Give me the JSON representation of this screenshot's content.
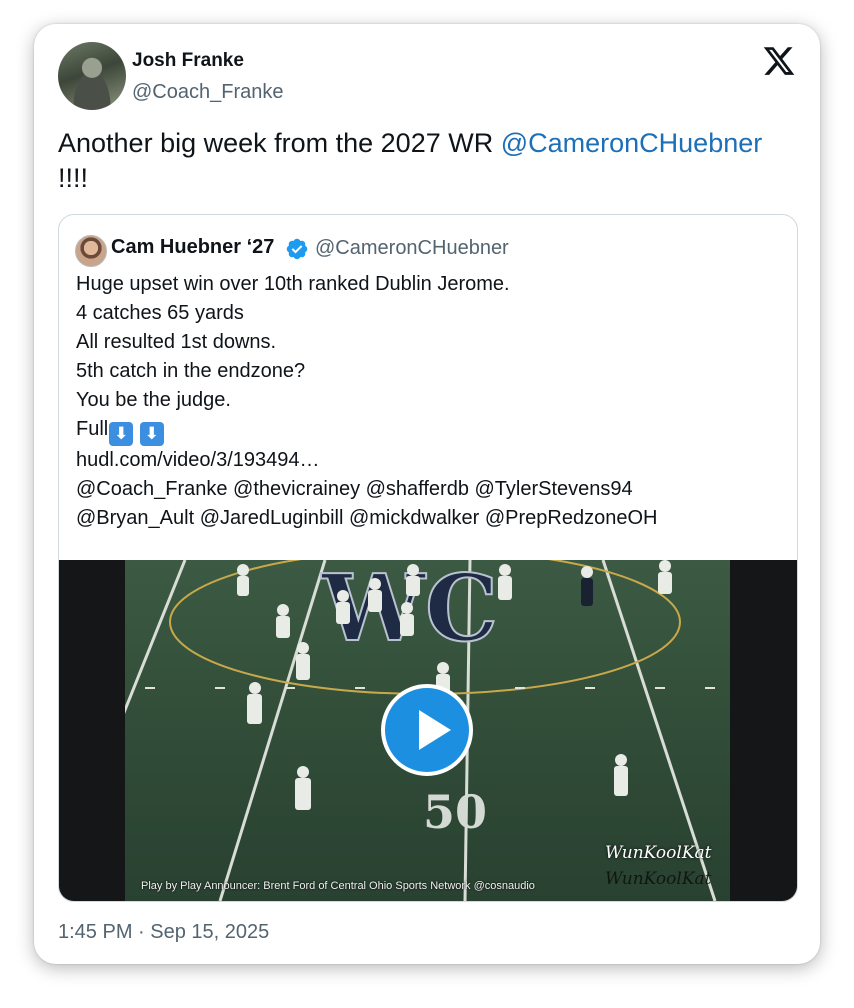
{
  "author": {
    "name": "Josh Franke",
    "handle": "@Coach_Franke"
  },
  "tweet": {
    "text_before": "Another big week from the 2027 WR ",
    "mention": "@CameronCHuebner",
    "text_after": "!!!!",
    "timestamp": "1:45 PM · Sep 15, 2025"
  },
  "quoted": {
    "name": "Cam Huebner ‘27",
    "handle": "@CameronCHuebner",
    "lines": [
      "Huge upset win over 10th ranked Dublin Jerome.",
      "4 catches 65 yards",
      "All resulted 1st downs.",
      "5th catch in the endzone?",
      "You be the judge.",
      "Full",
      "hudl.com/video/3/193494…",
      "@Coach_Franke @thevicrainey @shafferdb @TylerStevens94",
      "@Bryan_Ault @JaredLuginbill @mickdwalker @PrepRedzoneOH"
    ],
    "emoji": [
      "⬇",
      "⬇"
    ]
  },
  "video": {
    "caption": "Play by Play Announcer: Brent Ford of Central Ohio Sports Network @cosnaudio",
    "watermark": "WunKoolKat",
    "watermark_shadow": "WunKoolKat",
    "field_number": "50",
    "logo_letters": "WC"
  },
  "colors": {
    "mention": "#1d6fb8",
    "verified": "#1d9bf0",
    "play_button": "#1d8fe0"
  }
}
